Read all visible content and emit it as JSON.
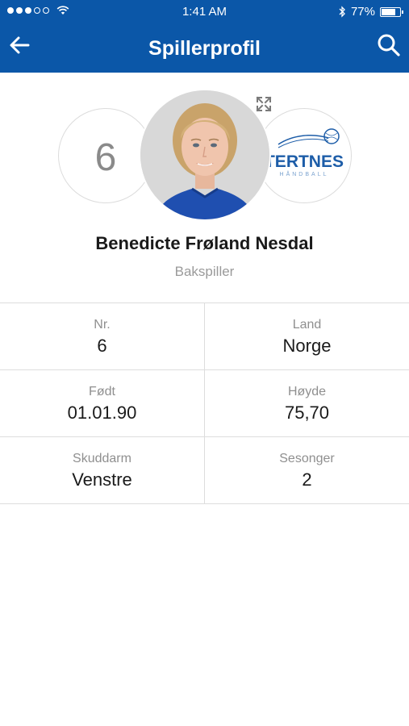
{
  "status_bar": {
    "time": "1:41 AM",
    "battery": "77%",
    "battery_level": 0.77,
    "signal_dots_filled": 3,
    "signal_dots_total": 5
  },
  "nav": {
    "title": "Spillerprofil",
    "back_icon": "arrow-left-icon",
    "search_icon": "search-icon"
  },
  "player": {
    "number": "6",
    "name": "Benedicte Frøland Nesdal",
    "position": "Bakspiller",
    "club_logo_text": "TERTNES",
    "club_logo_sub": "HÅNDBALL"
  },
  "stats": [
    [
      {
        "label": "Nr.",
        "value": "6"
      },
      {
        "label": "Land",
        "value": "Norge"
      }
    ],
    [
      {
        "label": "Født",
        "value": "01.01.90"
      },
      {
        "label": "Høyde",
        "value": "75,70"
      }
    ],
    [
      {
        "label": "Skuddarm",
        "value": "Venstre"
      },
      {
        "label": "Sesonger",
        "value": "2"
      }
    ]
  ],
  "colors": {
    "brand_blue": "#0b57a8",
    "logo_blue": "#1d5da8",
    "jersey_blue": "#1f4fb0"
  }
}
